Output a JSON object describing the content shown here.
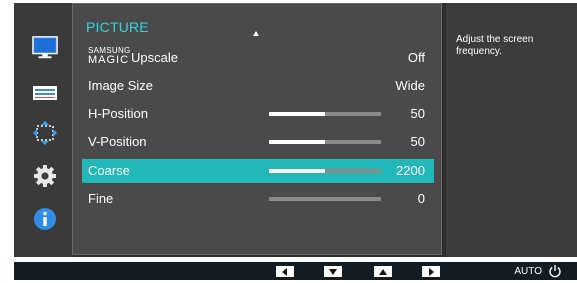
{
  "menu": {
    "title": "PICTURE",
    "items": [
      {
        "label_sup": "SAMSUNG",
        "label_word": "MAGIC",
        "label": "Upscale",
        "value": "Off"
      },
      {
        "label": "Image Size",
        "value": "Wide"
      },
      {
        "label": "H-Position",
        "value": "50",
        "level": 0.5
      },
      {
        "label": "V-Position",
        "value": "50",
        "level": 0.5
      },
      {
        "label": "Coarse",
        "value": "2200",
        "level": 0.5
      },
      {
        "label": "Fine",
        "value": "0",
        "level": 0
      }
    ],
    "selected_index": 4
  },
  "help": {
    "text": "Adjust the screen frequency."
  },
  "sidebar": {
    "icons": [
      "monitor-icon",
      "adjust-icon",
      "resize-icon",
      "gear-icon",
      "info-icon"
    ],
    "active": "monitor-icon"
  },
  "footer": {
    "buttons": [
      "left-arrow-icon",
      "down-arrow-icon",
      "up-arrow-icon",
      "right-arrow-icon"
    ],
    "auto_label": "AUTO",
    "power_icon": "power-icon"
  },
  "colors": {
    "accent": "#2fd4e0",
    "selected": "#22b7b9",
    "panel": "#4a4a4a",
    "background": "#2e2e2e"
  }
}
